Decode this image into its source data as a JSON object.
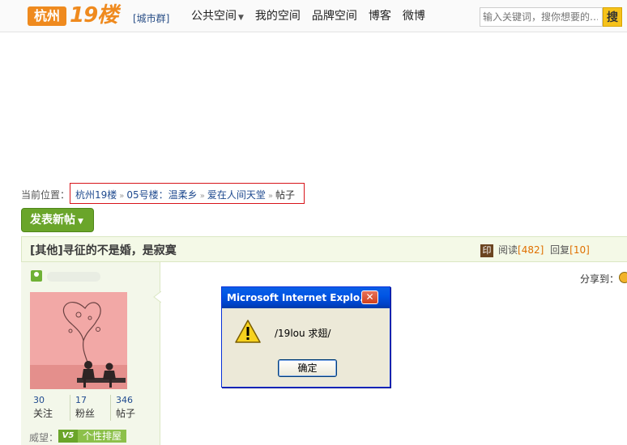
{
  "header": {
    "logo_city": "杭州",
    "logo_num": "19楼",
    "city_group": "[城市群]",
    "nav": [
      {
        "label": "公共空间",
        "has_dropdown": true
      },
      {
        "label": "我的空间",
        "has_dropdown": false
      },
      {
        "label": "品牌空间",
        "has_dropdown": false
      },
      {
        "label": "博客",
        "has_dropdown": false
      },
      {
        "label": "微博",
        "has_dropdown": false
      }
    ],
    "search_placeholder": "输入关键词，搜你想要的…",
    "search_button": "搜"
  },
  "breadcrumb": {
    "label": "当前位置：",
    "items": [
      "杭州19楼",
      "05号楼：温柔乡",
      "爱在人间天堂"
    ],
    "current": "帖子",
    "separator": "»"
  },
  "new_post_button": "发表新帖",
  "thread": {
    "title": "[其他]寻征的不是婚，是寂寞",
    "read_label": "阅读",
    "read_count": "[482]",
    "reply_label": "回复",
    "reply_count": "[10]"
  },
  "user": {
    "stats": [
      {
        "value": "30",
        "label": "关注"
      },
      {
        "value": "17",
        "label": "粉丝"
      },
      {
        "value": "346",
        "label": "帖子"
      }
    ],
    "prestige_label": "威望：",
    "badge": "V5",
    "rank_button": "个性排屋"
  },
  "share_label": "分享到：",
  "dialog": {
    "title": "Microsoft Internet Explo...",
    "message": "/19lou 求翅/",
    "ok_button": "确定"
  },
  "colors": {
    "brand_orange": "#ef8a1e",
    "link_blue": "#1f4a8f",
    "green_button": "#6aa52a",
    "highlight_red": "#d8141a"
  }
}
